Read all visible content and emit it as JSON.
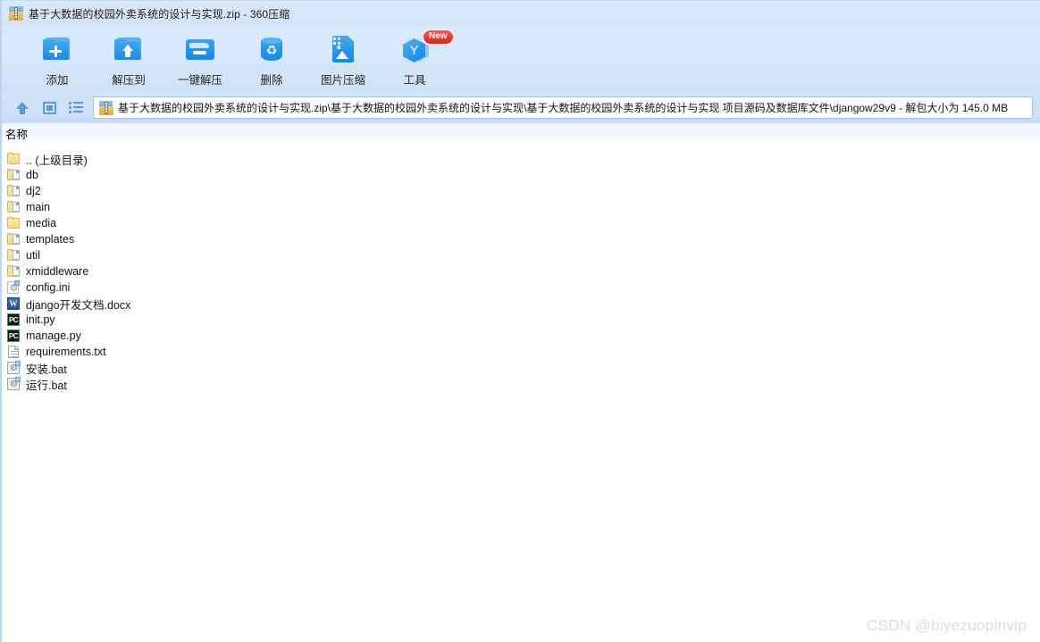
{
  "window": {
    "title": "基于大数据的校园外卖系统的设计与实现.zip - 360压缩",
    "title_icon": "zip-archive-icon"
  },
  "toolbar": {
    "buttons": [
      {
        "label": "添加",
        "icon": "folder-add-icon"
      },
      {
        "label": "解压到",
        "icon": "folder-extract-icon"
      },
      {
        "label": "一键解压",
        "icon": "one-click-extract-icon"
      },
      {
        "label": "删除",
        "icon": "trash-delete-icon"
      },
      {
        "label": "图片压缩",
        "icon": "image-compress-icon"
      },
      {
        "label": "工具",
        "icon": "tools-hexagon-icon",
        "badge": "New"
      }
    ]
  },
  "addressbar": {
    "up_button": "up-directory-icon",
    "view_button": "view-mode-icon",
    "list_button": "list-mode-icon",
    "path_icon": "zip-archive-icon",
    "path": "基于大数据的校园外卖系统的设计与实现.zip\\基于大数据的校园外卖系统的设计与实现\\基于大数据的校园外卖系统的设计与实现 项目源码及数据库文件\\djangow29v9  -  解包大小为 145.0 MB"
  },
  "columns": {
    "name": "名称"
  },
  "files": [
    {
      "name": ".. (上级目录)",
      "icon": "folder-up-icon",
      "type": "parent"
    },
    {
      "name": "db",
      "icon": "folder-icon",
      "type": "folder"
    },
    {
      "name": "dj2",
      "icon": "folder-icon",
      "type": "folder"
    },
    {
      "name": "main",
      "icon": "folder-icon",
      "type": "folder"
    },
    {
      "name": "media",
      "icon": "folder-plain-icon",
      "type": "folder"
    },
    {
      "name": "templates",
      "icon": "folder-icon",
      "type": "folder"
    },
    {
      "name": "util",
      "icon": "folder-icon",
      "type": "folder"
    },
    {
      "name": "xmiddleware",
      "icon": "folder-icon",
      "type": "folder"
    },
    {
      "name": "config.ini",
      "icon": "ini-file-icon",
      "type": "file"
    },
    {
      "name": "django开发文档.docx",
      "icon": "word-docx-icon",
      "type": "file"
    },
    {
      "name": "init.py",
      "icon": "python-file-icon",
      "type": "file"
    },
    {
      "name": "manage.py",
      "icon": "python-file-icon",
      "type": "file"
    },
    {
      "name": "requirements.txt",
      "icon": "text-file-icon",
      "type": "file"
    },
    {
      "name": "安装.bat",
      "icon": "batch-file-icon",
      "type": "file"
    },
    {
      "name": "运行.bat",
      "icon": "batch-file-icon",
      "type": "file"
    }
  ],
  "watermark": "CSDN @biyezuopinvip",
  "colors": {
    "titlebar": "#d7e7fa",
    "toolbar": "#d8e9fb",
    "addressbar": "#cfe2f8",
    "accent_blue": "#1189e8",
    "nav_icon_blue": "#5b9bd5",
    "badge_red": "#e0201c",
    "folder_yellow": "#f6d98a",
    "watermark": "#dcdcdc"
  }
}
